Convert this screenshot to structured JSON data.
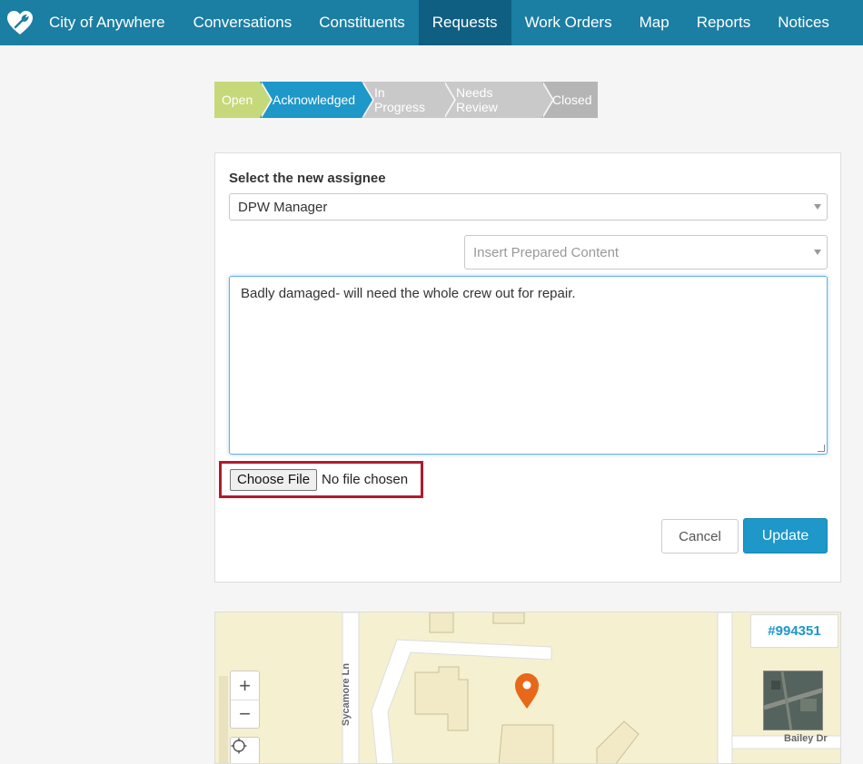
{
  "nav": {
    "brand": "City of Anywhere",
    "items": [
      {
        "label": "Conversations"
      },
      {
        "label": "Constituents"
      },
      {
        "label": "Requests"
      },
      {
        "label": "Work Orders"
      },
      {
        "label": "Map"
      },
      {
        "label": "Reports"
      },
      {
        "label": "Notices"
      }
    ],
    "active": "Requests"
  },
  "status_steps": {
    "open": "Open",
    "acknowledged": "Acknowledged",
    "in_progress": "In Progress",
    "needs_review": "Needs Review",
    "closed": "Closed",
    "current": "Acknowledged"
  },
  "form": {
    "assignee_label": "Select the new assignee",
    "assignee_value": "DPW Manager",
    "prepared_placeholder": "Insert Prepared Content",
    "comment_text": "Badly damaged- will need the whole crew out for repair.",
    "file_button": "Choose File",
    "file_status": "No file chosen",
    "cancel_label": "Cancel",
    "update_label": "Update"
  },
  "map": {
    "request_id": "#994351",
    "zoom_in": "+",
    "zoom_out": "−",
    "streets": {
      "sycamore": "Sycamore Ln",
      "bailey": "Bailey Dr"
    },
    "marker_color": "#e8681a"
  },
  "colors": {
    "nav_bg": "#1b7ea3",
    "nav_active": "#0e5f82",
    "accent": "#1e97c9",
    "step_open": "#c5d97a",
    "highlight_border": "#b01c2e"
  }
}
